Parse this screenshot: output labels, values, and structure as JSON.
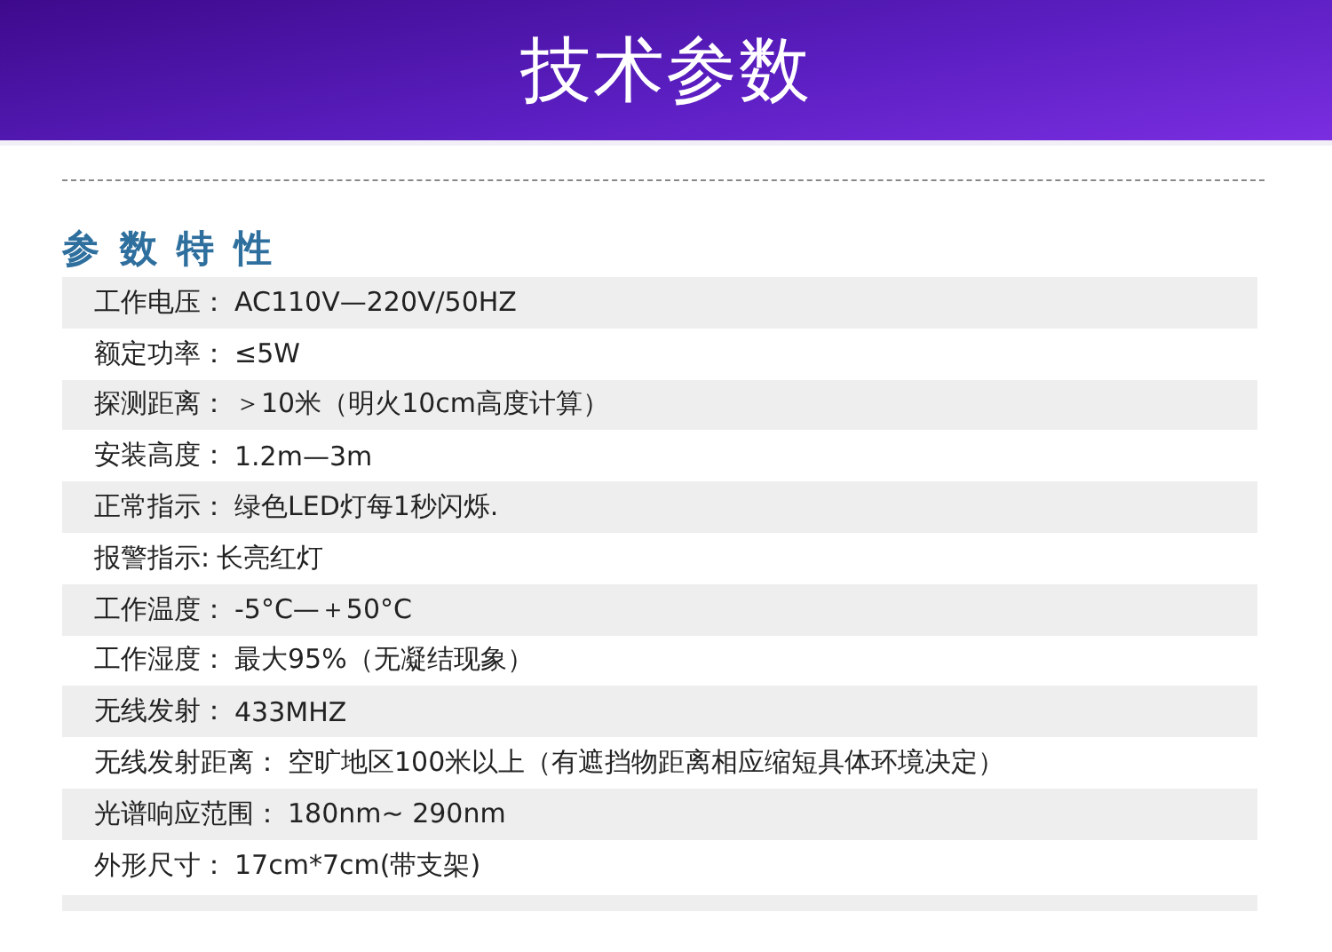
{
  "header": {
    "title": "技术参数"
  },
  "section": {
    "title": "参 数 特 性"
  },
  "specs": [
    {
      "label": "工作电压：",
      "value": "AC110V—220V/50HZ"
    },
    {
      "label": "额定功率：",
      "value": "≤5W"
    },
    {
      "label": "探测距离：",
      "value": "＞10米（明火10cm高度计算）"
    },
    {
      "label": "安装高度：",
      "value": "1.2m—3m"
    },
    {
      "label": "正常指示：",
      "value": "绿色LED灯每1秒闪烁."
    },
    {
      "label": "报警指示:",
      "value": "长亮红灯"
    },
    {
      "label": "工作温度：",
      "value": "-5°C—＋50°C"
    },
    {
      "label": "工作湿度：",
      "value": "最大95%（无凝结现象）"
    },
    {
      "label": "无线发射：",
      "value": "433MHZ"
    },
    {
      "label": "无线发射距离：",
      "value": "空旷地区100米以上（有遮挡物距离相应缩短具体环境决定）"
    },
    {
      "label": "光谱响应范围：",
      "value": "180nm~ 290nm"
    },
    {
      "label": "外形尺寸：",
      "value": "17cm*7cm(带支架)"
    }
  ]
}
